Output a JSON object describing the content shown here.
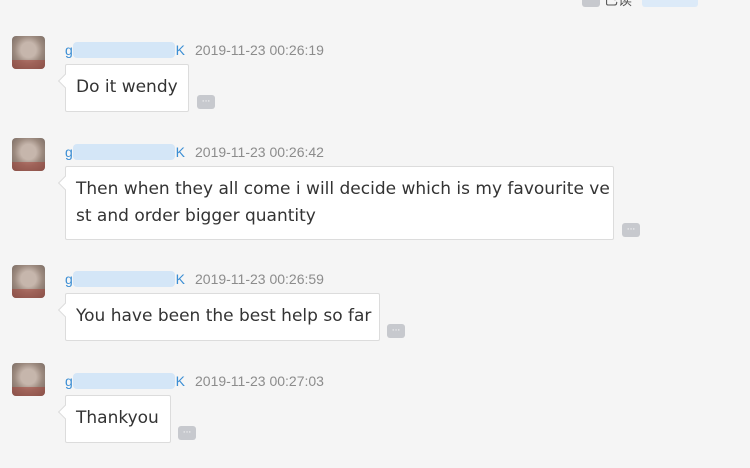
{
  "top_status": {
    "more_label": "···",
    "label": "已读"
  },
  "messages": [
    {
      "sender_first": "g",
      "sender_last": "K",
      "time": "2019-11-23 00:26:19",
      "lines": [
        "Do it wendy"
      ],
      "more_label": "···"
    },
    {
      "sender_first": "g",
      "sender_last": "K",
      "time": "2019-11-23 00:26:42",
      "lines": [
        "Then when they all come i will decide which is my favourite ve",
        "st and order bigger quantity"
      ],
      "more_label": "···"
    },
    {
      "sender_first": "g",
      "sender_last": "K",
      "time": "2019-11-23 00:26:59",
      "lines": [
        "You have been the best help so far"
      ],
      "more_label": "···"
    },
    {
      "sender_first": "g",
      "sender_last": "K",
      "time": "2019-11-23 00:27:03",
      "lines": [
        "Thankyou"
      ],
      "more_label": "···"
    }
  ]
}
